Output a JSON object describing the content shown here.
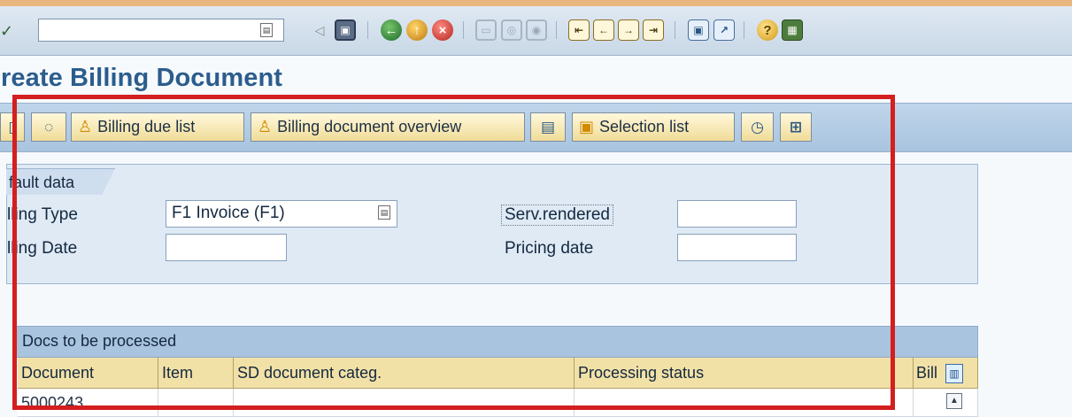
{
  "toolbar": {
    "command_value": "",
    "icons": [
      "back-icon",
      "save-icon",
      "green-back-icon",
      "exit-icon",
      "cancel-icon",
      "print-icon",
      "find-icon",
      "find-next-icon",
      "first-page-icon",
      "previous-page-icon",
      "next-page-icon",
      "last-page-icon",
      "create-session-icon",
      "shortcut-icon",
      "help-icon",
      "layout-icon"
    ]
  },
  "page": {
    "title": "reate Billing Document"
  },
  "app_toolbar": {
    "billing_due_list": "Billing due list",
    "billing_document_overview": "Billing document overview",
    "selection_list": "Selection list"
  },
  "default_data": {
    "tab_label": "fault data",
    "billing_type_label": "lling Type",
    "billing_type_value": "F1 Invoice (F1)",
    "billing_date_label": "lling Date",
    "billing_date_value": "",
    "serv_rendered_label": "Serv.rendered",
    "serv_rendered_value": "",
    "pricing_date_label": "Pricing date",
    "pricing_date_value": ""
  },
  "table": {
    "title": "Docs to be processed",
    "columns": [
      "Document",
      "Item",
      "SD document categ.",
      "Processing status",
      "Bill"
    ],
    "rows": [
      [
        "5000243",
        "",
        "",
        "",
        ""
      ]
    ]
  },
  "colors": {
    "title": "#2b5d8d",
    "annotation_border": "#d31f1f",
    "header": "#f2e1a7"
  }
}
